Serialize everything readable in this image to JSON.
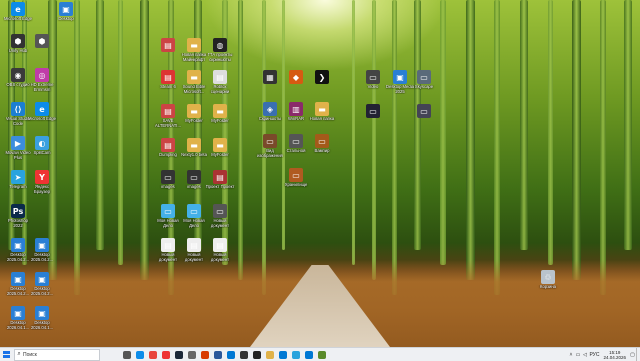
{
  "desktop": {
    "icons": [
      {
        "id": "icon-ms-edge",
        "label": "Microsoft Edge",
        "glyph": "e",
        "color": "#0c8ce9"
      },
      {
        "id": "icon-desktop-top",
        "label": "Desktop",
        "glyph": "▣",
        "color": "#2a7fd4"
      },
      {
        "id": "icon-unity-hub",
        "label": "Unity Hub",
        "glyph": "⬢",
        "color": "#333"
      },
      {
        "id": "icon-unity-2",
        "label": "",
        "glyph": "⬢",
        "color": "#555"
      },
      {
        "id": "icon-obs",
        "label": "OBS студио",
        "glyph": "◉",
        "color": "#3a3a3a"
      },
      {
        "id": "icon-hd-ext",
        "label": "HD Extreme Ermmsm",
        "glyph": "◎",
        "color": "#c03ca8"
      },
      {
        "id": "icon-vscode",
        "label": "Visual Studio Code",
        "glyph": "⟨⟩",
        "color": "#1c7fd1"
      },
      {
        "id": "icon-edge-2",
        "label": "Microsoft Edge",
        "glyph": "e",
        "color": "#0c8ce9"
      },
      {
        "id": "icon-movavi",
        "label": "Movavi Video Plus",
        "glyph": "▶",
        "color": "#3c8ddc"
      },
      {
        "id": "icon-splitcam",
        "label": "SplitCam",
        "glyph": "◐",
        "color": "#3aa0e0"
      },
      {
        "id": "icon-telegram",
        "label": "Telegram",
        "glyph": "➤",
        "color": "#2aa3dd"
      },
      {
        "id": "icon-yandex",
        "label": "Яндекс Браузер",
        "glyph": "Y",
        "color": "#e33"
      },
      {
        "id": "icon-photoshop",
        "label": "Photoshop 2022",
        "glyph": "Ps",
        "color": "#0b2a4a"
      },
      {
        "id": "icon-desktop-a",
        "label": "Desktop 2025.04.2...",
        "glyph": "▣",
        "color": "#2a7fd4"
      },
      {
        "id": "icon-desktop-b",
        "label": "Desktop 2025.04.2...",
        "glyph": "▣",
        "color": "#2a7fd4"
      },
      {
        "id": "icon-desktop-c",
        "label": "Desktop 2025.04.2...",
        "glyph": "▣",
        "color": "#2a7fd4"
      },
      {
        "id": "icon-desktop-d",
        "label": "Desktop 2025.04.2...",
        "glyph": "▣",
        "color": "#2a7fd4"
      },
      {
        "id": "icon-desktop-e",
        "label": "Desktop 2026.04.1...",
        "glyph": "▣",
        "color": "#2a7fd4"
      },
      {
        "id": "icon-desktop-f",
        "label": "Desktop 2026.04.1...",
        "glyph": "▣",
        "color": "#2a7fd4"
      },
      {
        "id": "icon-word-1",
        "label": "",
        "glyph": "▤",
        "color": "#c44"
      },
      {
        "id": "icon-folder-1",
        "label": "Новая папка Майнкрафт",
        "glyph": "▬",
        "color": "#e0b24a"
      },
      {
        "id": "icon-steam",
        "label": "ГТА проекты скриншоты",
        "glyph": "◍",
        "color": "#222"
      },
      {
        "id": "icon-word-2",
        "label": "Steam 6",
        "glyph": "▤",
        "color": "#d33"
      },
      {
        "id": "icon-folder-2",
        "label": "Sound Bible Microsoft...",
        "glyph": "▬",
        "color": "#e0b24a"
      },
      {
        "id": "icon-file-3",
        "label": "Roblox сценарии",
        "glyph": "▤",
        "color": "#ddd"
      },
      {
        "id": "icon-doc-4",
        "label": "SAVE ALTERNATI...",
        "glyph": "▤",
        "color": "#c44"
      },
      {
        "id": "icon-folder-3",
        "label": "MyFolder",
        "glyph": "▬",
        "color": "#e0b24a"
      },
      {
        "id": "icon-folder-4",
        "label": "MyFolder",
        "glyph": "▬",
        "color": "#e0b24a"
      },
      {
        "id": "icon-doc-5",
        "label": "Dumpling",
        "glyph": "▤",
        "color": "#c44"
      },
      {
        "id": "icon-folder-5",
        "label": "Nexty1.0 beta",
        "glyph": "▬",
        "color": "#e0b24a"
      },
      {
        "id": "icon-folder-6",
        "label": "MyFolder",
        "glyph": "▬",
        "color": "#e0b24a"
      },
      {
        "id": "icon-img-1",
        "label": "images",
        "glyph": "▭",
        "color": "#333"
      },
      {
        "id": "icon-img-2",
        "label": "images",
        "glyph": "▭",
        "color": "#333"
      },
      {
        "id": "icon-proj",
        "label": "Проект Проект",
        "glyph": "▤",
        "color": "#a33"
      },
      {
        "id": "icon-img-3",
        "label": "Моя Новая Дело",
        "glyph": "▭",
        "color": "#44b0e8"
      },
      {
        "id": "icon-img-4",
        "label": "Моя Новая Дело",
        "glyph": "▭",
        "color": "#44b0e8"
      },
      {
        "id": "icon-img-5",
        "label": "Новый документ",
        "glyph": "▭",
        "color": "#555"
      },
      {
        "id": "icon-txt-1",
        "label": "Новый документ",
        "glyph": "▤",
        "color": "#eee"
      },
      {
        "id": "icon-txt-2",
        "label": "Новый документ",
        "glyph": "▤",
        "color": "#eee"
      },
      {
        "id": "icon-txt-3",
        "label": "Новый документ",
        "glyph": "▤",
        "color": "#eee"
      },
      {
        "id": "icon-game-1",
        "label": "",
        "glyph": "▦",
        "color": "#333"
      },
      {
        "id": "icon-game-2",
        "label": "",
        "glyph": "◆",
        "color": "#d65a12"
      },
      {
        "id": "icon-game-3",
        "label": "",
        "glyph": "❯",
        "color": "#111"
      },
      {
        "id": "icon-app-1",
        "label": "Скриншоты",
        "glyph": "◈",
        "color": "#3a6fb0"
      },
      {
        "id": "icon-winrar",
        "label": "WinRAR",
        "glyph": "▥",
        "color": "#8a2a6a"
      },
      {
        "id": "icon-folder-7",
        "label": "Новая папка",
        "glyph": "▬",
        "color": "#e0b24a"
      },
      {
        "id": "icon-pic-1",
        "label": "Вид изображения",
        "glyph": "▭",
        "color": "#7a4a2a"
      },
      {
        "id": "icon-pic-2",
        "label": "Стальной",
        "glyph": "▭",
        "color": "#555"
      },
      {
        "id": "icon-pic-3",
        "label": "Вампир",
        "glyph": "▭",
        "color": "#a35a1a"
      },
      {
        "id": "icon-pic-4",
        "label": "Хранилище",
        "glyph": "▭",
        "color": "#b05a20"
      },
      {
        "id": "icon-pic-5",
        "label": "Video",
        "glyph": "▭",
        "color": "#444"
      },
      {
        "id": "icon-desktop-g",
        "label": "Desktop Media 2025",
        "glyph": "▣",
        "color": "#2a7fd4"
      },
      {
        "id": "icon-pic-6",
        "label": "Skyscape",
        "glyph": "▭",
        "color": "#5a6a7a"
      },
      {
        "id": "icon-pic-7",
        "label": "",
        "glyph": "▭",
        "color": "#223"
      },
      {
        "id": "icon-pic-8",
        "label": "",
        "glyph": "▭",
        "color": "#445"
      },
      {
        "id": "icon-recycle-bin",
        "label": "Корзина",
        "glyph": "♲",
        "color": "#b9c3cc"
      }
    ]
  },
  "taskbar": {
    "search_placeholder": "Поиск",
    "apps": [
      {
        "name": "task-view-icon",
        "color": "#555"
      },
      {
        "name": "edge-icon",
        "color": "#0c8ce9"
      },
      {
        "name": "chrome-icon",
        "color": "#e8453c"
      },
      {
        "name": "yandex-icon",
        "color": "#e33"
      },
      {
        "name": "steam-icon",
        "color": "#1b2838"
      },
      {
        "name": "settings-icon",
        "color": "#666"
      },
      {
        "name": "office-icon",
        "color": "#d83b01"
      },
      {
        "name": "word-icon",
        "color": "#2b579a"
      },
      {
        "name": "store-icon",
        "color": "#0078d4"
      },
      {
        "name": "files-icon",
        "color": "#333"
      },
      {
        "name": "unity-icon",
        "color": "#222"
      },
      {
        "name": "notes-icon",
        "color": "#e0b24a"
      },
      {
        "name": "photos-icon",
        "color": "#0078d4"
      },
      {
        "name": "telegram-icon",
        "color": "#2aa3dd"
      },
      {
        "name": "mail-icon",
        "color": "#0078d4"
      },
      {
        "name": "minecraft-icon",
        "color": "#5a8a2a"
      }
    ],
    "tray": {
      "lang": "РУС",
      "time": "15:19",
      "date": "24.04.2026"
    }
  },
  "colors": {
    "accent": "#1a73e8",
    "taskbar_bg": "#eef0f3"
  }
}
